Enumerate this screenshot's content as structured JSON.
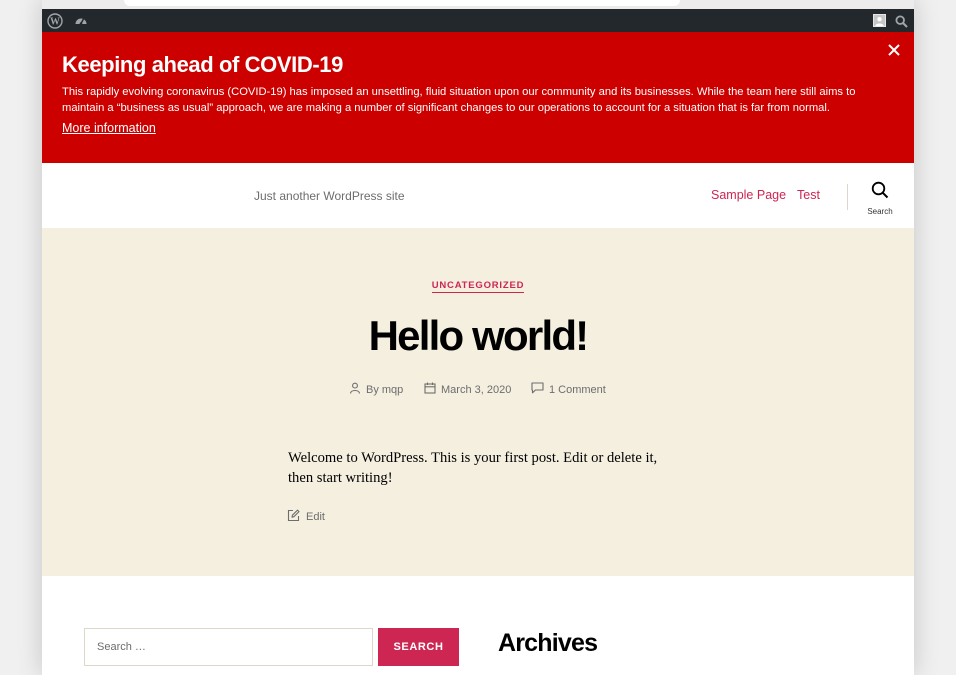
{
  "admin_bar": {
    "wp_icon": "wordpress-icon",
    "dashboard_icon": "dashboard-icon",
    "avatar_icon": "avatar-icon",
    "search_icon": "search-icon"
  },
  "notice": {
    "title": "Keeping ahead of COVID-19",
    "body": "This rapidly evolving coronavirus (COVID-19) has imposed an unsettling, fluid situation upon our community and its businesses. While the team here still aims to maintain a “business as usual” approach, we are making a number of significant changes to our operations to account for a situation that is far from normal.",
    "link": "More information",
    "close_icon": "close-icon",
    "color": "#cd0000"
  },
  "header": {
    "tagline": "Just another WordPress site",
    "nav": [
      {
        "label": "Sample Page"
      },
      {
        "label": "Test"
      }
    ],
    "search_label": "Search",
    "accent": "#cd2653"
  },
  "post": {
    "category": "UNCATEGORIZED",
    "title": "Hello world!",
    "author": "By mqp",
    "date": "March 3, 2020",
    "comments": "1 Comment",
    "content": "Welcome to WordPress. This is your first post. Edit or delete it, then start writing!",
    "edit": "Edit",
    "background": "#f5efe0"
  },
  "footer": {
    "search_placeholder": "Search …",
    "search_button": "SEARCH",
    "archives_title": "Archives"
  }
}
